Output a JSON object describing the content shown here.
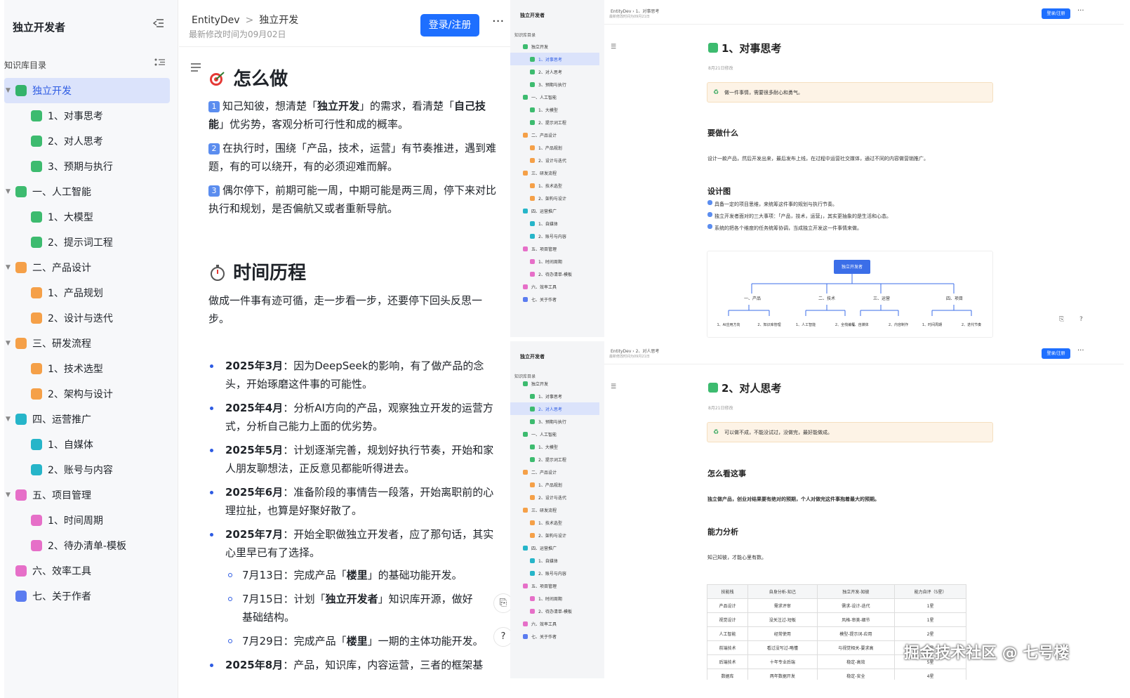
{
  "left_sidebar": {
    "title": "独立开发者",
    "dir_label": "知识库目录",
    "items": [
      {
        "label": "独立开发",
        "level": 0,
        "color": "#34b36b",
        "caret": "▼",
        "active": true
      },
      {
        "label": "1、对事思考",
        "level": 1,
        "color": "#3dbb6f"
      },
      {
        "label": "2、对人思考",
        "level": 1,
        "color": "#3dbb6f"
      },
      {
        "label": "3、预期与执行",
        "level": 1,
        "color": "#3dbb6f"
      },
      {
        "label": "一、人工智能",
        "level": 0,
        "color": "#3dbb6f",
        "caret": "▼"
      },
      {
        "label": "1、大模型",
        "level": 1,
        "color": "#3dbb6f"
      },
      {
        "label": "2、提示词工程",
        "level": 1,
        "color": "#3dbb6f"
      },
      {
        "label": "二、产品设计",
        "level": 0,
        "color": "#f5a048",
        "caret": "▼"
      },
      {
        "label": "1、产品规划",
        "level": 1,
        "color": "#f5a048"
      },
      {
        "label": "2、设计与迭代",
        "level": 1,
        "color": "#f5a048"
      },
      {
        "label": "三、研发流程",
        "level": 0,
        "color": "#f5a048",
        "caret": "▼"
      },
      {
        "label": "1、技术选型",
        "level": 1,
        "color": "#f5a048"
      },
      {
        "label": "2、架构与设计",
        "level": 1,
        "color": "#f5a048"
      },
      {
        "label": "四、运营推广",
        "level": 0,
        "color": "#26b5c9",
        "caret": "▼"
      },
      {
        "label": "1、自媒体",
        "level": 1,
        "color": "#26b5c9"
      },
      {
        "label": "2、账号与内容",
        "level": 1,
        "color": "#26b5c9"
      },
      {
        "label": "五、项目管理",
        "level": 0,
        "color": "#e66fc8",
        "caret": "▼"
      },
      {
        "label": "1、时间周期",
        "level": 1,
        "color": "#e66fc8"
      },
      {
        "label": "2、待办清单-模板",
        "level": 1,
        "color": "#e66fc8"
      },
      {
        "label": "六、效率工具",
        "level": 0,
        "color": "#e66fc8"
      },
      {
        "label": "七、关于作者",
        "level": 0,
        "color": "#5b7cf0"
      }
    ]
  },
  "main": {
    "breadcrumb": [
      "EntityDev",
      "独立开发"
    ],
    "modified": "最新修改时间为09月02日",
    "login_label": "登录/注册",
    "more_label": "···",
    "section1_title": "怎么做",
    "p1_prefix": "知己知彼，想清楚「",
    "p1_bold1": "独立开发",
    "p1_mid": "」的需求，看清楚「",
    "p1_bold2": "自己技能",
    "p1_suffix": "」优劣势，客观分析可行性和成的概率。",
    "p2": "在执行时，围绕「产品，技术，运营」有节奏推进，遇到难题，有的可以绕开，有的必须迎难而解。",
    "p3": "偶尔停下，前期可能一周，中期可能是两三周，停下来对比执行和规划，是否偏航又或者重新导航。",
    "num1": "1",
    "num2": "2",
    "num3": "3",
    "section2_title": "时间历程",
    "p4": "做成一件事有迹可循，走一步看一步，还要停下回头反思一步。",
    "timeline": [
      {
        "date": "2025年3月",
        "text": "：因为DeepSeek的影响，有了做产品的念头，开始琢磨这件事的可能性。"
      },
      {
        "date": "2025年4月",
        "text": "：分析AI方向的产品，观察独立开发的运营方式，分析自己能力上面的优劣势。"
      },
      {
        "date": "2025年5月",
        "text": "：计划逐渐完善，规划好执行节奏，开始和家人朋友聊想法，正反意见都能听得进去。"
      },
      {
        "date": "2025年6月",
        "text": "：准备阶段的事情告一段落，开始离职前的心理拉扯，也算是好聚好散了。"
      },
      {
        "date": "2025年7月",
        "text": "：开始全职做独立开发者，应了那句话，其实心里早已有了选择。"
      }
    ],
    "subs": [
      {
        "pre": "7月13日：完成产品「",
        "bold": "楼里",
        "post": "」的基础功能开发。"
      },
      {
        "pre": "7月15日：计划「",
        "bold": "独立开发者",
        "post": "」知识库开源，做好基础结构。"
      },
      {
        "pre": "7月29日：完成产品「",
        "bold": "楼里",
        "post": "」一期的主体功能开发。"
      }
    ],
    "last": {
      "date": "2025年8月",
      "text": "：产品，知识库，内容运营，三者的框架基"
    }
  },
  "mini_sidebar": {
    "title": "独立开发者",
    "dir_label": "知识库目录",
    "items": [
      {
        "label": "独立开发",
        "color": "#3dbb6f",
        "indent": 0
      },
      {
        "label": "1、对事思考",
        "color": "#3dbb6f",
        "indent": 1
      },
      {
        "label": "2、对人思考",
        "color": "#3dbb6f",
        "indent": 1
      },
      {
        "label": "3、预期与执行",
        "color": "#3dbb6f",
        "indent": 1
      },
      {
        "label": "一、人工智能",
        "color": "#3dbb6f",
        "indent": 0
      },
      {
        "label": "1、大模型",
        "color": "#3dbb6f",
        "indent": 1
      },
      {
        "label": "2、提示词工程",
        "color": "#3dbb6f",
        "indent": 1
      },
      {
        "label": "二、产品设计",
        "color": "#f5a048",
        "indent": 0
      },
      {
        "label": "1、产品规划",
        "color": "#f5a048",
        "indent": 1
      },
      {
        "label": "2、设计与迭代",
        "color": "#f5a048",
        "indent": 1
      },
      {
        "label": "三、研发流程",
        "color": "#f5a048",
        "indent": 0
      },
      {
        "label": "1、技术选型",
        "color": "#f5a048",
        "indent": 1
      },
      {
        "label": "2、架构与设计",
        "color": "#f5a048",
        "indent": 1
      },
      {
        "label": "四、运营推广",
        "color": "#26b5c9",
        "indent": 0
      },
      {
        "label": "1、自媒体",
        "color": "#26b5c9",
        "indent": 1
      },
      {
        "label": "2、账号与内容",
        "color": "#26b5c9",
        "indent": 1
      },
      {
        "label": "五、项目管理",
        "color": "#e66fc8",
        "indent": 0
      },
      {
        "label": "1、时间周期",
        "color": "#e66fc8",
        "indent": 1
      },
      {
        "label": "2、待办清单-模板",
        "color": "#e66fc8",
        "indent": 1
      },
      {
        "label": "六、效率工具",
        "color": "#e66fc8",
        "indent": 0
      },
      {
        "label": "七、关于作者",
        "color": "#5b7cf0",
        "indent": 0
      }
    ]
  },
  "panel1": {
    "breadcrumb": "EntityDev › 1、对事思考",
    "modified": "最新修改时间为09月21日",
    "login_label": "登录/注册",
    "title": "1、对事思考",
    "date": "8月21日修改",
    "note": "做一件事情，需要很多耐心和勇气。",
    "h_what": "要做什么",
    "what_text": "设计一款产品，然后开发出来，最后发布上线，在过程中运营社交媒体，通过不同的内容做营销推广。",
    "h_design": "设计图",
    "design_lines": [
      "具备一定的项目思维，来统筹这件事的规划与执行节奏。",
      "独立开发者面对的三大事项：「产品，技术，运营」，其实更抽象的是生活和心态。",
      "系统的把各个维度的任务统筹协调，当成独立开发这一件事情来做。"
    ],
    "diagram": {
      "root": "独立开发者",
      "groups": [
        {
          "label": "一、产品",
          "children": [
            "1、AI应用方向",
            "2、知识库管理"
          ]
        },
        {
          "label": "二、技术",
          "children": [
            "1、人工智能",
            "2、全栈编程"
          ]
        },
        {
          "label": "三、运营",
          "children": [
            "1、自媒体",
            "2、内容制作"
          ]
        },
        {
          "label": "四、项目",
          "children": [
            "1、时间周期",
            "2、迭代节奏"
          ]
        }
      ]
    }
  },
  "panel2": {
    "breadcrumb": "EntityDev › 2、对人思考",
    "modified": "最新修改时间为09月21日",
    "login_label": "登录/注册",
    "title": "2、对人思考",
    "date": "8月21日修改",
    "note": "可以做不成，不能没试过，没做完，最好能做成。",
    "h_see": "怎么看这事",
    "see_text": "独立做产品，创业对结果要有绝对的预期，个人对做完这件事抱着最大的预期。",
    "h_ability": "能力分析",
    "ability_text": "知己知彼，才能心里有数。",
    "table": {
      "headers": [
        "技能栈",
        "自身分析-知己",
        "独立开发-知彼",
        "能力自评（5星）"
      ],
      "rows": [
        [
          "产品设计",
          "需求评审",
          "需求-设计-迭代",
          "1星"
        ],
        [
          "视觉设计",
          "没关注过-短板",
          "风格-审美-细节",
          "1星"
        ],
        [
          "人工智能",
          "经常使用",
          "模型-提示词-应用",
          "2星"
        ],
        [
          "前端技术",
          "看过没写过-略懂",
          "与视觉相关-要求高",
          "5星"
        ],
        [
          "后端技术",
          "十年专业后端",
          "稳定-高效",
          "5星"
        ],
        [
          "数据库",
          "两年数据开发",
          "稳定-安全",
          "4星"
        ]
      ]
    }
  },
  "watermark": "掘金技术社区 @ 七号楼"
}
